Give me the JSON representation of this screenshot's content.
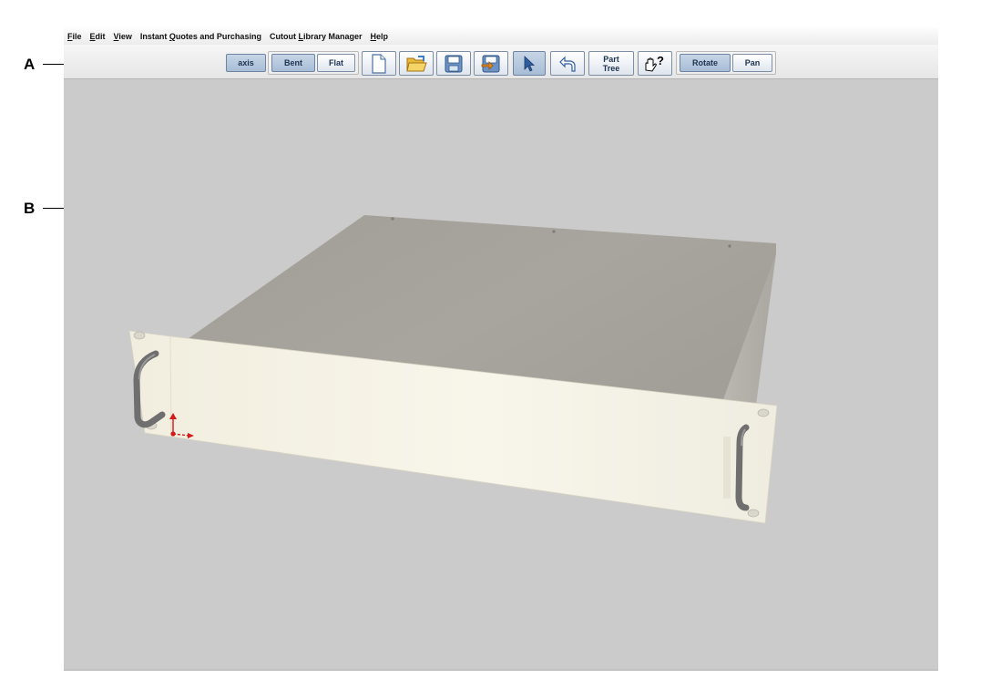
{
  "menubar": {
    "items": [
      {
        "label": "File",
        "mnemonic": "F",
        "rest": "ile"
      },
      {
        "label": "Edit",
        "mnemonic": "E",
        "rest": "dit"
      },
      {
        "label": "View",
        "mnemonic": "V",
        "rest": "iew"
      },
      {
        "label": "Instant Quotes and Purchasing",
        "pre": "Instant ",
        "mnemonic": "Q",
        "rest": "uotes and Purchasing"
      },
      {
        "label": "Cutout Library Manager",
        "pre": "Cutout ",
        "mnemonic": "L",
        "rest": "ibrary Manager"
      },
      {
        "label": "Help",
        "mnemonic": "H",
        "rest": "elp"
      }
    ]
  },
  "toolbar": {
    "axis_label": "axis",
    "bent_label": "Bent",
    "flat_label": "Flat",
    "part_tree_line1": "Part",
    "part_tree_line2": "Tree",
    "rotate_label": "Rotate",
    "pan_label": "Pan",
    "icons": {
      "new": "new-document-icon",
      "open": "open-folder-icon",
      "save": "save-disk-icon",
      "export": "export-icon",
      "select": "select-arrow-icon",
      "undo": "undo-arrow-icon",
      "help": "help-hand-icon"
    }
  },
  "callouts": {
    "a": "A",
    "b": "B"
  },
  "colors": {
    "viewport_bg": "#cbcbcb",
    "enclosure_top": "#a9a69f",
    "front_panel": "#f4f1e4",
    "handle": "#6f6f6f",
    "axis_marker": "#d41a1a",
    "active_button": "#b4c7dc"
  }
}
